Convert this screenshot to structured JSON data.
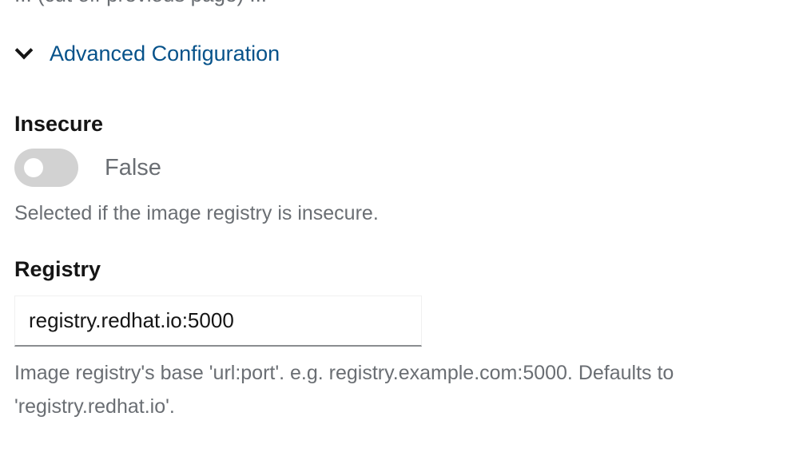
{
  "previous_field": {
    "helper_text_cutoff": "... (cut off previous page) ..."
  },
  "advanced": {
    "label": "Advanced Configuration",
    "icon": "chevron-down-icon"
  },
  "insecure": {
    "label": "Insecure",
    "state": false,
    "state_text": "False",
    "helper": "Selected if the image registry is insecure."
  },
  "registry": {
    "label": "Registry",
    "value": "registry.redhat.io:5000",
    "helper": "Image registry's base 'url:port'. e.g. registry.example.com:5000. Defaults to 'registry.redhat.io'."
  },
  "colors": {
    "link": "#06528a",
    "muted_text": "#6a6e73",
    "switch_off": "#d2d2d2"
  }
}
